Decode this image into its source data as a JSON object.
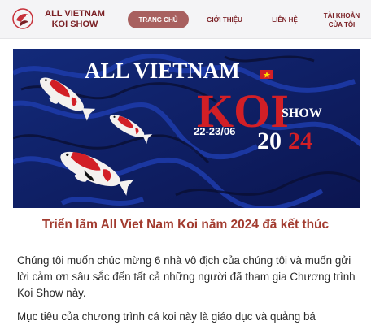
{
  "header": {
    "logo_icon": "koi-fish-logo-icon",
    "logo_line1": "ALL VIETNAM",
    "logo_line2": "KOI SHOW",
    "nav": {
      "home": "TRANG CHỦ",
      "about": "GIỚI THIỆU",
      "contact": "LIÊN HỆ",
      "account_line1": "TÀI KHOẢN",
      "account_line2": "CỦA TÔI"
    }
  },
  "banner": {
    "title_line1": "ALL VIETNAM",
    "title_koi": "KOI",
    "title_show": "SHOW",
    "dates": "22-23/06",
    "year_part1": "20",
    "year_part2": "24",
    "flag_icon": "vietnam-flag-icon",
    "colors": {
      "background": "#0f1f66",
      "accent_red": "#d21f26",
      "title_white": "#ffffff"
    }
  },
  "article": {
    "headline": "Triển lãm All Viet Nam Koi năm 2024 đã kết thúc",
    "paragraph1": "Chúng tôi muốn chúc mừng 6 nhà vô địch của chúng tôi và muốn gửi lời cảm ơn sâu sắc đến tất cả những người đã tham gia Chương trình Koi Show này.",
    "paragraph2": "Mục tiêu của chương trình cá koi này là giáo dục và quảng bá"
  }
}
